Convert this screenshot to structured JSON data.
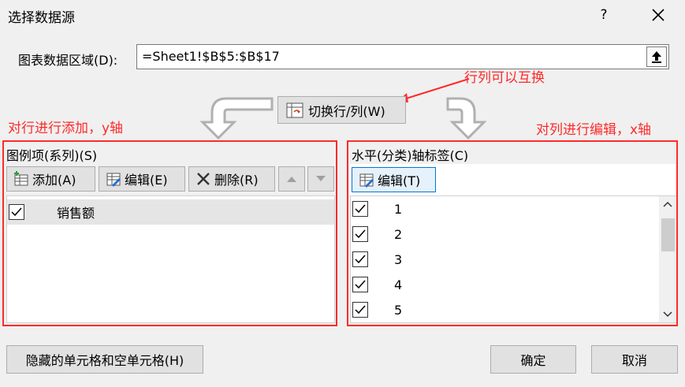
{
  "window": {
    "title": "选择数据源",
    "help": "?",
    "close_icon": "close-icon"
  },
  "range": {
    "label": "图表数据区域(D):",
    "value": "=Sheet1!$B$5:$B$17"
  },
  "switch_button": "切换行/列(W)",
  "annotations": {
    "swap": "行列可以互换",
    "left": "对行进行添加，y轴",
    "right": "对列进行编辑，x轴",
    "color": "#ff2a2a"
  },
  "legend_panel": {
    "label": "图例项(系列)(S)",
    "add": "添加(A)",
    "edit": "编辑(E)",
    "delete": "删除(R)",
    "items": [
      {
        "checked": true,
        "label": "销售额"
      }
    ]
  },
  "axis_panel": {
    "label": "水平(分类)轴标签(C)",
    "edit": "编辑(T)",
    "items": [
      {
        "checked": true,
        "label": "1"
      },
      {
        "checked": true,
        "label": "2"
      },
      {
        "checked": true,
        "label": "3"
      },
      {
        "checked": true,
        "label": "4"
      },
      {
        "checked": true,
        "label": "5"
      }
    ]
  },
  "bottom": {
    "hidden_cells": "隐藏的单元格和空单元格(H)",
    "ok": "确定",
    "cancel": "取消"
  }
}
